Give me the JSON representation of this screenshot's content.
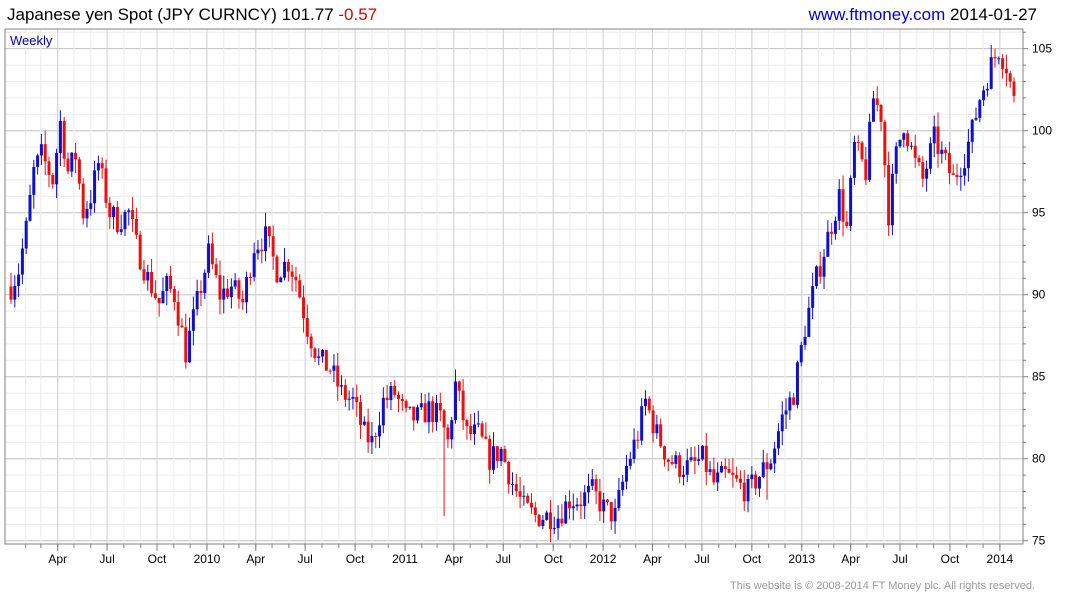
{
  "header": {
    "title": "Japanese yen Spot (JPY CURNCY)",
    "last": "101.77",
    "change": "-0.57",
    "site": "www.ftmoney.com",
    "date": "2014-01-27"
  },
  "footer": {
    "copyright": "This website is © 2008-2014 FT Money plc. All rights reserved."
  },
  "colors": {
    "up": "#1010c8",
    "down": "#e81010",
    "grid": "#d4d4d4",
    "frame": "#808080",
    "text": "#000000"
  },
  "chart_data": {
    "type": "candlestick",
    "periodicity_label": "Weekly",
    "ylim": [
      74.8,
      106.2
    ],
    "yticks": [
      75,
      80,
      85,
      90,
      95,
      100,
      105
    ],
    "x_start": "2009-01-05",
    "x_end": "2014-01-27",
    "xticks": [
      {
        "label": "Apr",
        "date": "2009-04-01"
      },
      {
        "label": "Jul",
        "date": "2009-07-01"
      },
      {
        "label": "Oct",
        "date": "2009-10-01"
      },
      {
        "label": "2010",
        "date": "2010-01-01"
      },
      {
        "label": "Apr",
        "date": "2010-04-01"
      },
      {
        "label": "Jul",
        "date": "2010-07-01"
      },
      {
        "label": "Oct",
        "date": "2010-10-01"
      },
      {
        "label": "2011",
        "date": "2011-01-01"
      },
      {
        "label": "Apr",
        "date": "2011-04-01"
      },
      {
        "label": "Jul",
        "date": "2011-07-01"
      },
      {
        "label": "Oct",
        "date": "2011-10-01"
      },
      {
        "label": "2012",
        "date": "2012-01-01"
      },
      {
        "label": "Apr",
        "date": "2012-04-01"
      },
      {
        "label": "Jul",
        "date": "2012-07-01"
      },
      {
        "label": "Oct",
        "date": "2012-10-01"
      },
      {
        "label": "2013",
        "date": "2013-01-01"
      },
      {
        "label": "Apr",
        "date": "2013-04-01"
      },
      {
        "label": "Jul",
        "date": "2013-07-01"
      },
      {
        "label": "Oct",
        "date": "2013-10-01"
      },
      {
        "label": "2014",
        "date": "2014-01-01"
      }
    ],
    "close_path": [
      [
        "2009-01-05",
        90.5
      ],
      [
        "2009-01-19",
        91.5
      ],
      [
        "2009-02-02",
        94
      ],
      [
        "2009-02-16",
        97.5
      ],
      [
        "2009-03-02",
        98.5
      ],
      [
        "2009-03-23",
        97
      ],
      [
        "2009-04-06",
        100.5
      ],
      [
        "2009-04-20",
        97.5
      ],
      [
        "2009-05-04",
        98.5
      ],
      [
        "2009-05-18",
        95
      ],
      [
        "2009-06-01",
        96
      ],
      [
        "2009-06-15",
        98
      ],
      [
        "2009-07-06",
        95
      ],
      [
        "2009-07-20",
        94.5
      ],
      [
        "2009-08-10",
        95
      ],
      [
        "2009-08-24",
        93
      ],
      [
        "2009-09-14",
        91
      ],
      [
        "2009-10-05",
        89.5
      ],
      [
        "2009-10-19",
        90.5
      ],
      [
        "2009-11-02",
        90
      ],
      [
        "2009-11-23",
        86.5
      ],
      [
        "2009-12-14",
        89.5
      ],
      [
        "2010-01-04",
        92.5
      ],
      [
        "2010-01-25",
        90
      ],
      [
        "2010-02-15",
        90.5
      ],
      [
        "2010-03-08",
        89.5
      ],
      [
        "2010-03-29",
        93
      ],
      [
        "2010-04-19",
        93.5
      ],
      [
        "2010-05-10",
        91.5
      ],
      [
        "2010-05-31",
        92
      ],
      [
        "2010-06-14",
        91
      ],
      [
        "2010-07-05",
        88
      ],
      [
        "2010-07-26",
        86
      ],
      [
        "2010-08-16",
        85.5
      ],
      [
        "2010-09-06",
        84
      ],
      [
        "2010-09-27",
        83.5
      ],
      [
        "2010-10-18",
        81.5
      ],
      [
        "2010-11-01",
        81
      ],
      [
        "2010-11-22",
        83.5
      ],
      [
        "2010-12-13",
        84
      ],
      [
        "2011-01-03",
        82.5
      ],
      [
        "2011-01-24",
        82.5
      ],
      [
        "2011-02-14",
        83
      ],
      [
        "2011-03-07",
        82.5
      ],
      [
        "2011-03-21",
        81
      ],
      [
        "2011-04-04",
        84.5
      ],
      [
        "2011-04-25",
        81.5
      ],
      [
        "2011-05-16",
        81.5
      ],
      [
        "2011-06-06",
        80
      ],
      [
        "2011-06-27",
        80.5
      ],
      [
        "2011-07-18",
        78.5
      ],
      [
        "2011-08-08",
        77
      ],
      [
        "2011-08-29",
        76.5
      ],
      [
        "2011-09-19",
        76.5
      ],
      [
        "2011-10-10",
        76.5
      ],
      [
        "2011-10-31",
        77.5
      ],
      [
        "2011-11-21",
        77.5
      ],
      [
        "2011-12-12",
        78
      ],
      [
        "2012-01-02",
        77
      ],
      [
        "2012-01-23",
        76.5
      ],
      [
        "2012-02-13",
        79.5
      ],
      [
        "2012-03-05",
        81.5
      ],
      [
        "2012-03-19",
        83.5
      ],
      [
        "2012-04-09",
        81.5
      ],
      [
        "2012-04-30",
        80
      ],
      [
        "2012-05-21",
        79.5
      ],
      [
        "2012-06-11",
        79.5
      ],
      [
        "2012-07-02",
        80
      ],
      [
        "2012-07-23",
        78.5
      ],
      [
        "2012-08-13",
        79
      ],
      [
        "2012-09-03",
        78.5
      ],
      [
        "2012-09-24",
        78
      ],
      [
        "2012-10-15",
        79
      ],
      [
        "2012-11-05",
        80
      ],
      [
        "2012-11-26",
        82.5
      ],
      [
        "2012-12-17",
        84
      ],
      [
        "2013-01-07",
        88
      ],
      [
        "2013-01-28",
        91
      ],
      [
        "2013-02-18",
        93.5
      ],
      [
        "2013-03-11",
        96
      ],
      [
        "2013-03-25",
        94
      ],
      [
        "2013-04-08",
        99
      ],
      [
        "2013-04-29",
        97.5
      ],
      [
        "2013-05-13",
        102
      ],
      [
        "2013-05-27",
        101
      ],
      [
        "2013-06-10",
        95
      ],
      [
        "2013-06-24",
        98.5
      ],
      [
        "2013-07-08",
        100.5
      ],
      [
        "2013-07-29",
        98
      ],
      [
        "2013-08-12",
        97
      ],
      [
        "2013-09-02",
        99.5
      ],
      [
        "2013-09-16",
        98.5
      ],
      [
        "2013-10-07",
        97
      ],
      [
        "2013-10-28",
        98.5
      ],
      [
        "2013-11-11",
        100
      ],
      [
        "2013-11-25",
        102
      ],
      [
        "2013-12-16",
        104
      ],
      [
        "2013-12-30",
        105
      ],
      [
        "2014-01-13",
        104
      ],
      [
        "2014-01-27",
        101.8
      ]
    ],
    "spikes": [
      [
        "2009-01-19",
        93
      ],
      [
        "2009-03-30",
        97
      ],
      [
        "2009-11-23",
        85.5
      ],
      [
        "2010-06-28",
        89
      ],
      [
        "2011-03-14",
        76.5
      ],
      [
        "2012-10-29",
        77.5
      ],
      [
        "2013-06-10",
        94
      ]
    ]
  }
}
